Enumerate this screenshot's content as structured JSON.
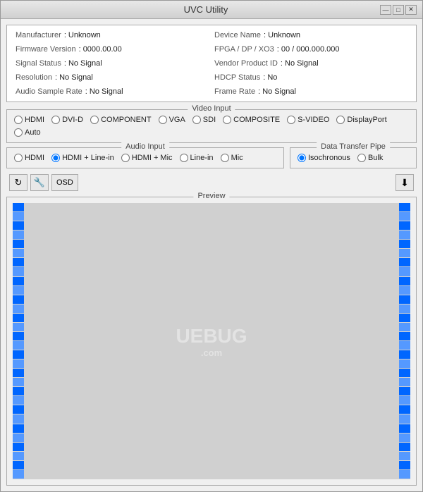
{
  "window": {
    "title": "UVC Utility",
    "controls": {
      "minimize": "—",
      "maximize": "□",
      "close": "✕"
    }
  },
  "info": {
    "manufacturer_label": "Manufacturer",
    "manufacturer_value": ": Unknown",
    "firmware_label": "Firmware Version",
    "firmware_value": ": 0000.00.00",
    "signal_label": "Signal Status",
    "signal_value": ": No Signal",
    "resolution_label": "Resolution",
    "resolution_value": ": No Signal",
    "audio_label": "Audio Sample Rate",
    "audio_value": ": No Signal",
    "device_label": "Device Name",
    "device_value": ": Unknown",
    "fpga_label": "FPGA / DP / XO3",
    "fpga_value": ": 00 / 000.000.000",
    "vendor_label": "Vendor Product ID",
    "vendor_value": ": No Signal",
    "hdcp_label": "HDCP Status",
    "hdcp_value": ": No",
    "framerate_label": "Frame Rate",
    "framerate_value": ": No Signal"
  },
  "video_input": {
    "legend": "Video Input",
    "options": [
      {
        "id": "hdmi",
        "label": "HDMI",
        "checked": false
      },
      {
        "id": "dvi-d",
        "label": "DVI-D",
        "checked": false
      },
      {
        "id": "component",
        "label": "COMPONENT",
        "checked": false
      },
      {
        "id": "vga",
        "label": "VGA",
        "checked": false
      },
      {
        "id": "sdi",
        "label": "SDI",
        "checked": false
      },
      {
        "id": "composite",
        "label": "COMPOSITE",
        "checked": false
      },
      {
        "id": "s-video",
        "label": "S-VIDEO",
        "checked": false
      },
      {
        "id": "displayport",
        "label": "DisplayPort",
        "checked": false
      },
      {
        "id": "auto",
        "label": "Auto",
        "checked": false
      }
    ]
  },
  "audio_input": {
    "legend": "Audio Input",
    "options": [
      {
        "id": "hdmi",
        "label": "HDMI",
        "checked": false
      },
      {
        "id": "hdmi-line-in",
        "label": "HDMI + Line-in",
        "checked": true
      },
      {
        "id": "hdmi-mic",
        "label": "HDMI + Mic",
        "checked": false
      },
      {
        "id": "line-in",
        "label": "Line-in",
        "checked": false
      },
      {
        "id": "mic",
        "label": "Mic",
        "checked": false
      }
    ]
  },
  "data_transfer": {
    "legend": "Data Transfer Pipe",
    "options": [
      {
        "id": "isochronous",
        "label": "Isochronous",
        "checked": true
      },
      {
        "id": "bulk",
        "label": "Bulk",
        "checked": false
      }
    ]
  },
  "toolbar": {
    "refresh_icon": "↻",
    "settings_icon": "🔧",
    "osd_label": "OSD",
    "download_icon": "⬇"
  },
  "preview": {
    "legend": "Preview",
    "watermark": "UEBUG",
    "watermark_sub": ".com"
  }
}
